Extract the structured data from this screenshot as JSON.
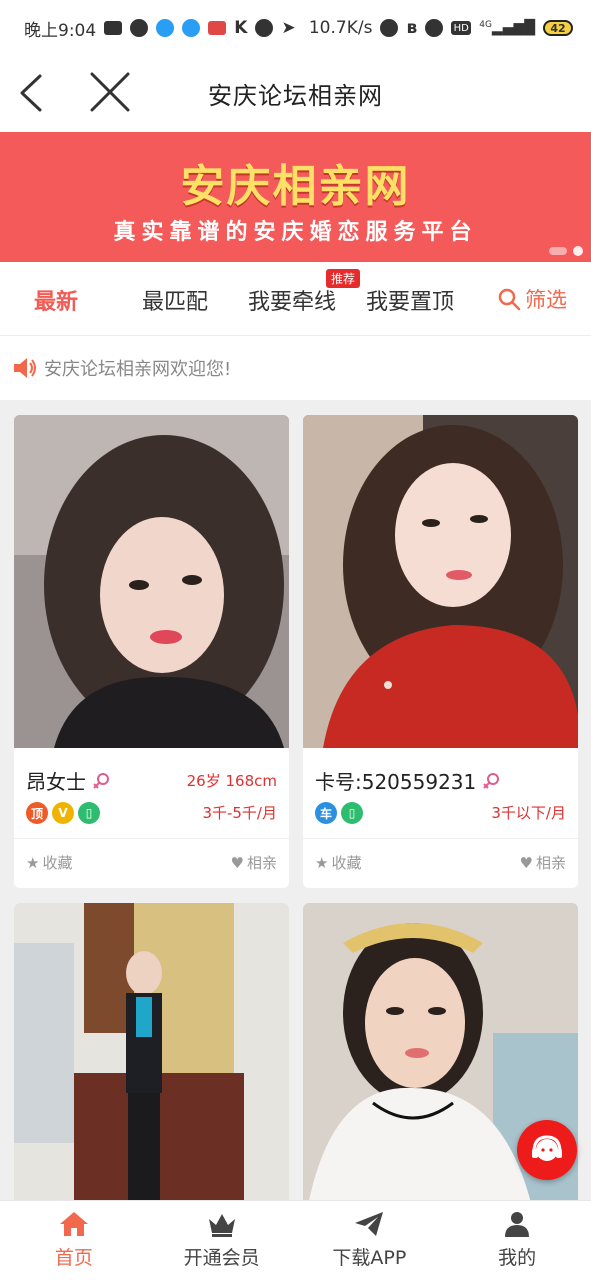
{
  "status_bar": {
    "time": "晚上9:04",
    "network_speed": "10.7K/s",
    "battery": "42",
    "net_type": "4G",
    "hd": "HD"
  },
  "header": {
    "title": "安庆论坛相亲网"
  },
  "banner": {
    "title": "安庆相亲网",
    "subtitle": "真实靠谱的安庆婚恋服务平台"
  },
  "tabs": [
    {
      "label": "最新"
    },
    {
      "label": "最匹配"
    },
    {
      "label": "我要牵线",
      "badge": "推荐"
    },
    {
      "label": "我要置顶"
    }
  ],
  "filter_label": "筛选",
  "notice": "安庆论坛相亲网欢迎您!",
  "cards": [
    {
      "name": "昂女士",
      "age_height": "26岁 168cm",
      "income": "3千-5千/月",
      "badges": [
        {
          "text": "顶",
          "color": "#f05a28"
        },
        {
          "text": "V",
          "color": "#f0b400"
        },
        {
          "text": "▯",
          "color": "#2ebd6e"
        }
      ],
      "fav_label": "收藏",
      "like_label": "相亲"
    },
    {
      "name": "卡号:520559231",
      "age_height": "",
      "income": "3千以下/月",
      "badges": [
        {
          "text": "车",
          "color": "#2d8fe0"
        },
        {
          "text": "▯",
          "color": "#2ebd6e"
        }
      ],
      "fav_label": "收藏",
      "like_label": "相亲"
    },
    {
      "name": "",
      "age_height": "",
      "income": ""
    },
    {
      "name": "",
      "age_height": "",
      "income": ""
    }
  ],
  "bottom_nav": [
    {
      "label": "首页",
      "icon": "home-icon"
    },
    {
      "label": "开通会员",
      "icon": "crown-icon"
    },
    {
      "label": "下载APP",
      "icon": "send-icon"
    },
    {
      "label": "我的",
      "icon": "user-icon"
    }
  ],
  "colors": {
    "accent": "#f2684d",
    "banner_bg": "#f45a5a",
    "banner_title": "#ffe066",
    "price": "#e03131"
  }
}
